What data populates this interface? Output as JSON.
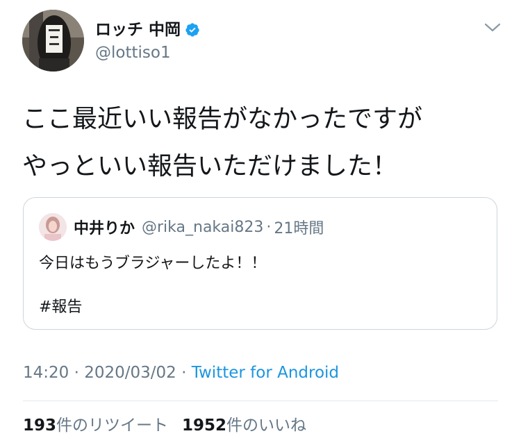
{
  "author": {
    "display_name": "ロッチ 中岡",
    "handle": "@lottiso1",
    "verified": true
  },
  "tweet": {
    "lines": [
      "ここ最近いい報告がなかったですが",
      "やっといい報告いただけました！"
    ]
  },
  "quoted_tweet": {
    "display_name": "中井りか",
    "handle": "@rika_nakai823",
    "separator": "·",
    "time_ago": "21時間",
    "body": "今日はもうブラジャーしたよ！！",
    "hashtag": "#報告"
  },
  "meta": {
    "time": "14:20",
    "separator1": " · ",
    "date": "2020/03/02",
    "separator2": " · ",
    "source": "Twitter for Android"
  },
  "stats": {
    "retweets_count": "193",
    "retweets_label": "件のリツイート",
    "likes_count": "1952",
    "likes_label": "件のいいね"
  },
  "colors": {
    "accent": "#1b95e0",
    "verified": "#1da1f2",
    "secondary_text": "#657786",
    "border": "#ccd6dd"
  },
  "icons": {
    "verified": "verified-badge-icon",
    "caret": "chevron-down-icon"
  }
}
